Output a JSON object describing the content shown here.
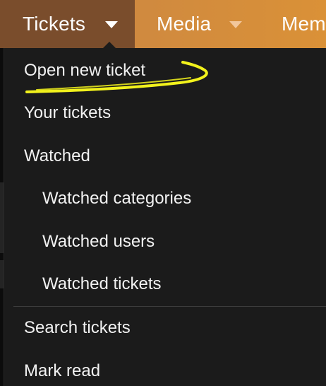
{
  "navbar": {
    "tabs": [
      {
        "label": "Tickets",
        "active": true
      },
      {
        "label": "Media",
        "active": false
      },
      {
        "label": "Mem",
        "active": false
      }
    ]
  },
  "dropdown": {
    "items": [
      {
        "label": "Open new ticket",
        "indent": 0
      },
      {
        "label": "Your tickets",
        "indent": 0
      },
      {
        "label": "Watched",
        "indent": 0
      },
      {
        "label": "Watched categories",
        "indent": 1
      },
      {
        "label": "Watched users",
        "indent": 1
      },
      {
        "label": "Watched tickets",
        "indent": 1
      },
      {
        "label": "Search tickets",
        "indent": 0
      },
      {
        "label": "Mark read",
        "indent": 0
      }
    ]
  },
  "colors": {
    "navbar_gradient_start": "#c9813f",
    "navbar_gradient_end": "#da9137",
    "active_tab": "#7a4d2c",
    "menu_background": "#1b1b1b",
    "menu_text": "#f2f2f2",
    "annotation_stroke": "#f2f21c"
  },
  "icons": {
    "tickets_caret": "caret-down-icon",
    "media_caret": "caret-down-icon"
  }
}
